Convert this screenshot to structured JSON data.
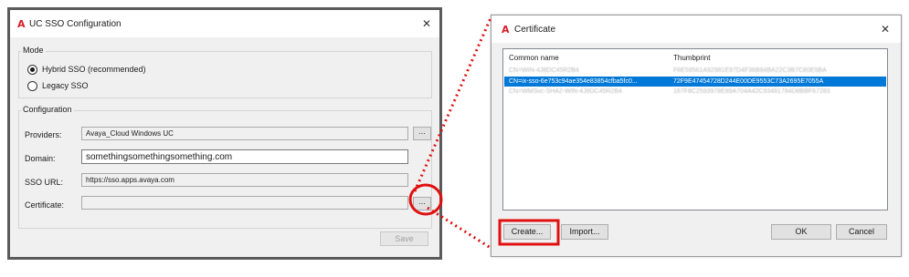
{
  "sso_dialog": {
    "logo": "A",
    "title": "UC SSO Configuration",
    "close_symbol": "✕",
    "mode_group": {
      "legend": "Mode",
      "options": [
        {
          "label": "Hybrid SSO (recommended)",
          "selected": true
        },
        {
          "label": "Legacy SSO",
          "selected": false
        }
      ]
    },
    "config_group": {
      "legend": "Configuration",
      "providers_label": "Providers:",
      "providers_value": "Avaya_Cloud Windows UC",
      "domain_label": "Domain:",
      "domain_value": "somethingsomethingsomething.com",
      "sso_url_label": "SSO URL:",
      "sso_url_value": "https://sso.apps.avaya.com",
      "certificate_label": "Certificate:",
      "certificate_value": "",
      "browse_label": "..."
    },
    "save_label": "Save"
  },
  "certificate_dialog": {
    "logo": "A",
    "title": "Certificate",
    "close_symbol": "✕",
    "columns": [
      "Common name",
      "Thumbprint"
    ],
    "rows": [
      {
        "name": "CN=WIN-4J8DC45R2B4",
        "thumbprint": "F6E59561A92981E97D4F36B84BA22C3B7C80E5BA",
        "selected": false,
        "obscured": true
      },
      {
        "name": "CN=ix-sso-6e753c94ae354e83854cfba5fc0...",
        "thumbprint": "72F9E47454728D244E00DE9553C73A2695E7055A",
        "selected": true,
        "obscured": false
      },
      {
        "name": "CN=WMSvc-SHA2-WIN-4J8DC45R2B4",
        "thumbprint": "167F8C2593978E89A704A42C93481784D8BBF67283",
        "selected": false,
        "obscured": true
      }
    ],
    "create_label": "Create...",
    "import_label": "Import...",
    "ok_label": "OK",
    "cancel_label": "Cancel"
  },
  "annotation_color": "#e01010"
}
